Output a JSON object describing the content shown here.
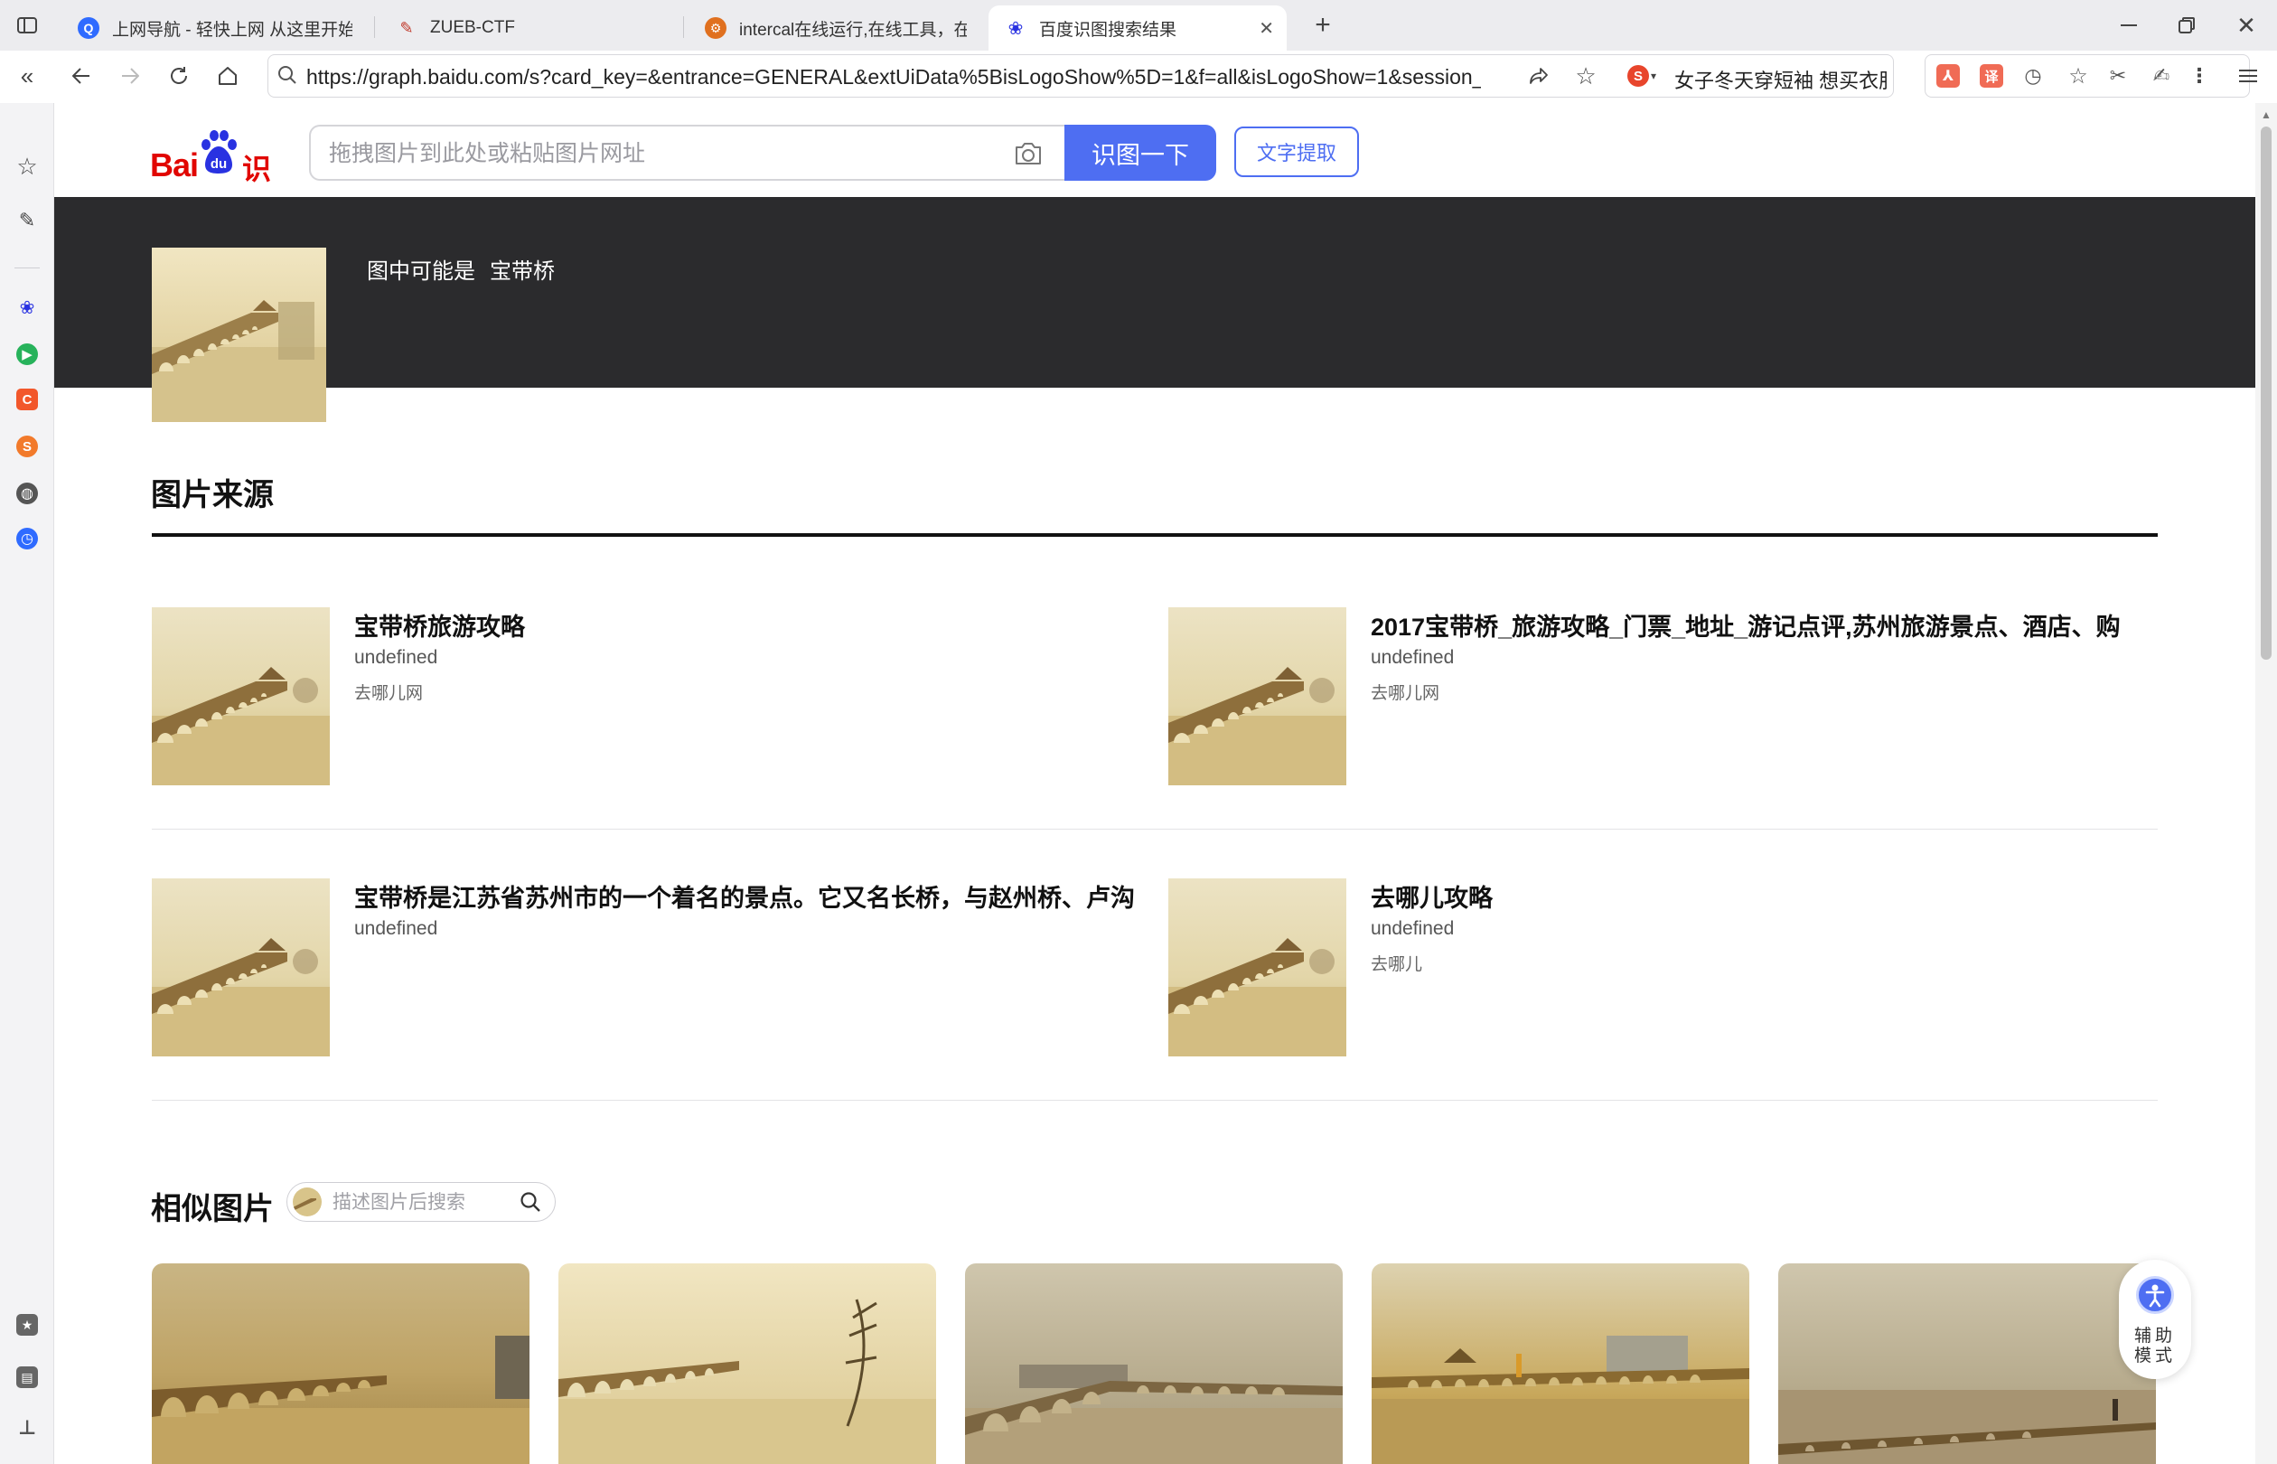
{
  "browser": {
    "tabs": [
      {
        "title": "上网导航 - 轻快上网 从这里开始",
        "icon": "search-q-favicon",
        "color": "#2f6bff"
      },
      {
        "title": "ZUEB-CTF",
        "icon": "ctf-favicon",
        "color": "#c0392b"
      },
      {
        "title": "intercal在线运行,在线工具，在线",
        "icon": "tool-favicon",
        "color": "#e0701f"
      },
      {
        "title": "百度识图搜索结果",
        "icon": "baidu-paw-favicon",
        "color": "#2932e1"
      }
    ],
    "url": "https://graph.baidu.com/s?card_key=&entrance=GENERAL&extUiData%5BisLogoShow%5D=1&f=all&isLogoShow=1&session_id",
    "search_suggestion": "女子冬天穿短袖 想买衣服"
  },
  "header": {
    "logo_bai": "Bai",
    "logo_du": "du",
    "logo_shitu": "识图",
    "search_placeholder": "拖拽图片到此处或粘贴图片网址",
    "search_button": "识图一下",
    "ocr_button": "文字提取"
  },
  "hero": {
    "guess_prefix": "图中可能是",
    "guess_answer": "宝带桥"
  },
  "sources": {
    "title": "图片来源",
    "items": [
      {
        "title": "宝带桥旅游攻略",
        "subtitle": "undefined",
        "site": "去哪儿网"
      },
      {
        "title": "2017宝带桥_旅游攻略_门票_地址_游记点评,苏州旅游景点、酒店、购",
        "subtitle": "undefined",
        "site": "去哪儿网"
      },
      {
        "title": "宝带桥是江苏省苏州市的一个着名的景点。它又名长桥，与赵州桥、卢沟",
        "subtitle": "undefined",
        "site": ""
      },
      {
        "title": "去哪儿攻略",
        "subtitle": "undefined",
        "site": "去哪儿"
      }
    ]
  },
  "similar": {
    "title": "相似图片",
    "search_placeholder": "描述图片后搜索"
  },
  "assist": {
    "label": "辅助模式"
  },
  "colors": {
    "baidu_blue": "#4e6ef2",
    "baidu_red": "#e10601",
    "hero_bg": "#2b2b2d"
  }
}
